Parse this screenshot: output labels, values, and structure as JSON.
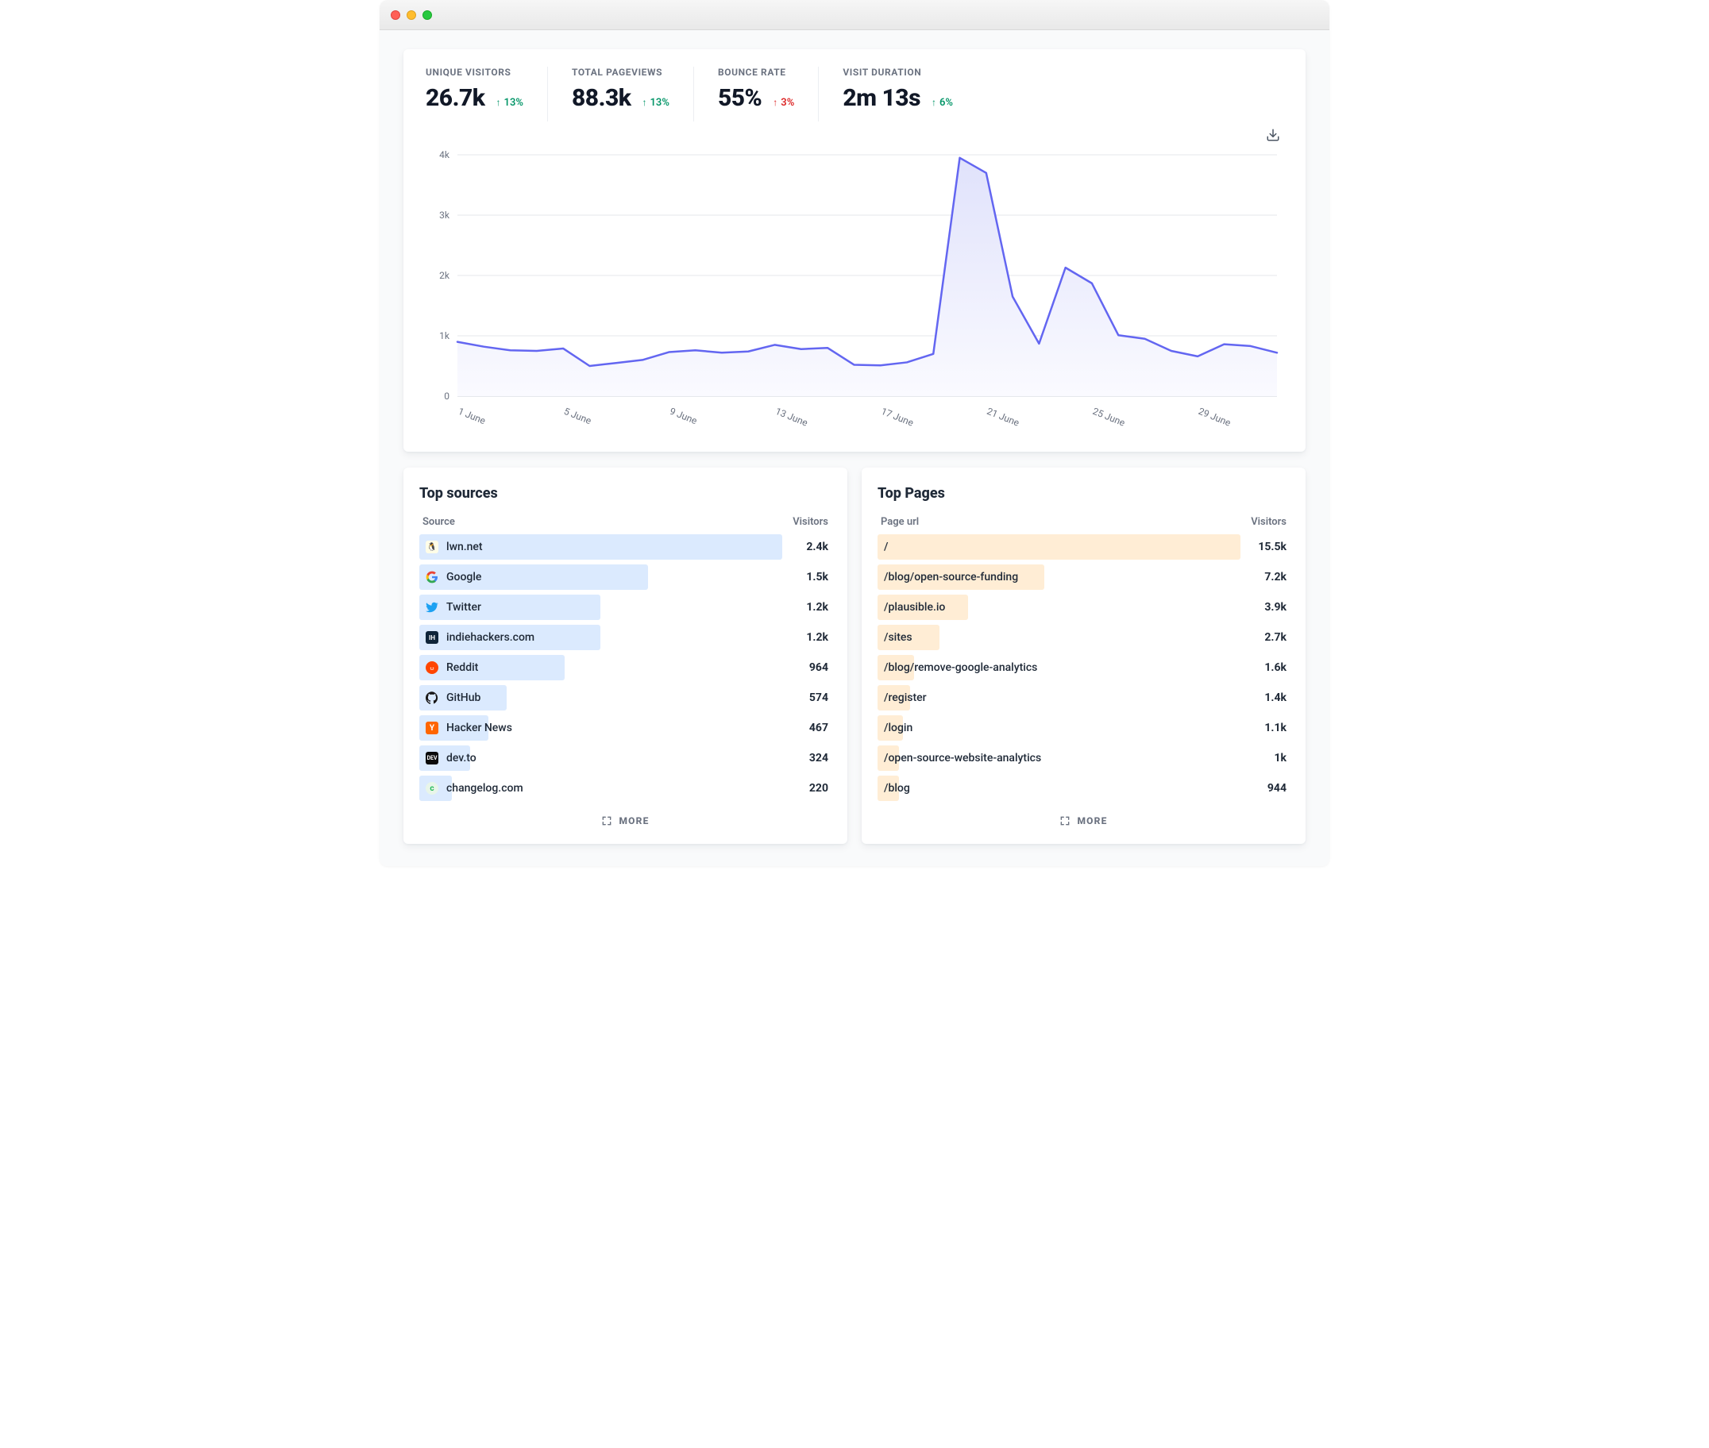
{
  "stats": [
    {
      "label": "UNIQUE VISITORS",
      "value": "26.7k",
      "change": "13%",
      "dir": "up"
    },
    {
      "label": "TOTAL PAGEVIEWS",
      "value": "88.3k",
      "change": "13%",
      "dir": "up"
    },
    {
      "label": "BOUNCE RATE",
      "value": "55%",
      "change": "3%",
      "dir": "down"
    },
    {
      "label": "VISIT DURATION",
      "value": "2m 13s",
      "change": "6%",
      "dir": "up"
    }
  ],
  "chart_data": {
    "type": "area",
    "title": "",
    "xlabel": "",
    "ylabel": "",
    "ylim": [
      0,
      4000
    ],
    "y_ticks": [
      "0",
      "1k",
      "2k",
      "3k",
      "4k"
    ],
    "x_tick_labels": [
      "1 June",
      "5 June",
      "9 June",
      "13 June",
      "17 June",
      "21 June",
      "25 June",
      "29 June"
    ],
    "x": [
      1,
      2,
      3,
      4,
      5,
      6,
      7,
      8,
      9,
      10,
      11,
      12,
      13,
      14,
      15,
      16,
      17,
      18,
      19,
      20,
      21,
      22,
      23,
      24,
      25,
      26,
      27,
      28,
      29,
      30
    ],
    "values": [
      900,
      820,
      760,
      750,
      790,
      500,
      550,
      600,
      730,
      760,
      720,
      740,
      850,
      780,
      800,
      520,
      510,
      560,
      700,
      3950,
      3700,
      1650,
      870,
      2130,
      1870,
      1010,
      950,
      750,
      660,
      860,
      830,
      720
    ],
    "series_color": "#6366f1",
    "fill_top": "#e0e2fb",
    "fill_bottom": "#fafaff"
  },
  "sources": {
    "title": "Top sources",
    "col1": "Source",
    "col2": "Visitors",
    "more": "MORE",
    "items": [
      {
        "name": "lwn.net",
        "value": "2.4k",
        "pct": 100,
        "icon": "lwn"
      },
      {
        "name": "Google",
        "value": "1.5k",
        "pct": 63,
        "icon": "google"
      },
      {
        "name": "Twitter",
        "value": "1.2k",
        "pct": 50,
        "icon": "twitter"
      },
      {
        "name": "indiehackers.com",
        "value": "1.2k",
        "pct": 50,
        "icon": "ih"
      },
      {
        "name": "Reddit",
        "value": "964",
        "pct": 40,
        "icon": "reddit"
      },
      {
        "name": "GitHub",
        "value": "574",
        "pct": 24,
        "icon": "github"
      },
      {
        "name": "Hacker News",
        "value": "467",
        "pct": 19,
        "icon": "hn"
      },
      {
        "name": "dev.to",
        "value": "324",
        "pct": 14,
        "icon": "devto"
      },
      {
        "name": "changelog.com",
        "value": "220",
        "pct": 9,
        "icon": "changelog"
      }
    ]
  },
  "pages": {
    "title": "Top Pages",
    "col1": "Page url",
    "col2": "Visitors",
    "more": "MORE",
    "items": [
      {
        "name": "/",
        "value": "15.5k",
        "pct": 100
      },
      {
        "name": "/blog/open-source-funding",
        "value": "7.2k",
        "pct": 46
      },
      {
        "name": "/plausible.io",
        "value": "3.9k",
        "pct": 25
      },
      {
        "name": "/sites",
        "value": "2.7k",
        "pct": 17
      },
      {
        "name": "/blog/remove-google-analytics",
        "value": "1.6k",
        "pct": 10
      },
      {
        "name": "/register",
        "value": "1.4k",
        "pct": 9
      },
      {
        "name": "/login",
        "value": "1.1k",
        "pct": 7
      },
      {
        "name": "/open-source-website-analytics",
        "value": "1k",
        "pct": 6
      },
      {
        "name": "/blog",
        "value": "944",
        "pct": 6
      }
    ]
  }
}
